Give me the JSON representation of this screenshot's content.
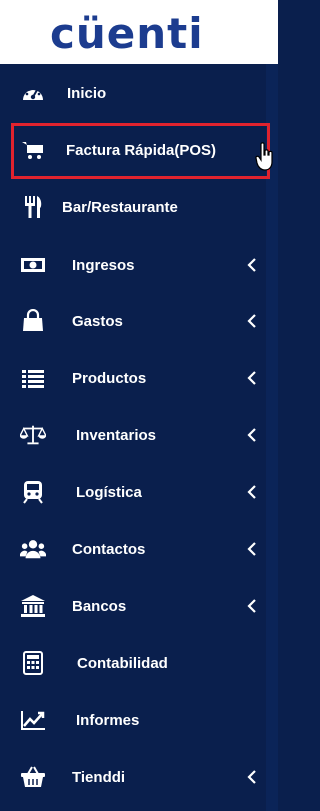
{
  "brand": {
    "name": "cüenti"
  },
  "colors": {
    "sidebar_bg": "#0a1f4d",
    "logo_text": "#1c3c8f",
    "logo_dots": "#2fa8e6",
    "highlight_border": "#e0232e",
    "text": "#ffffff"
  },
  "menu": [
    {
      "label": "Inicio",
      "icon": "dashboard-gauge-icon",
      "has_submenu": false
    },
    {
      "label": "Factura Rápida(POS)",
      "icon": "shopping-cart-icon",
      "has_submenu": false,
      "highlighted": true
    },
    {
      "label": "Bar/Restaurante",
      "icon": "fork-knife-icon",
      "has_submenu": false
    },
    {
      "label": "Ingresos",
      "icon": "money-bill-icon",
      "has_submenu": true
    },
    {
      "label": "Gastos",
      "icon": "shopping-bag-icon",
      "has_submenu": true
    },
    {
      "label": "Productos",
      "icon": "list-icon",
      "has_submenu": true
    },
    {
      "label": "Inventarios",
      "icon": "balance-scale-icon",
      "has_submenu": true
    },
    {
      "label": "Logística",
      "icon": "train-icon",
      "has_submenu": true
    },
    {
      "label": "Contactos",
      "icon": "users-icon",
      "has_submenu": true
    },
    {
      "label": "Bancos",
      "icon": "bank-icon",
      "has_submenu": true
    },
    {
      "label": "Contabilidad",
      "icon": "calculator-icon",
      "has_submenu": false
    },
    {
      "label": "Informes",
      "icon": "line-chart-icon",
      "has_submenu": false
    },
    {
      "label": "Tienddi",
      "icon": "basket-icon",
      "has_submenu": true
    }
  ]
}
